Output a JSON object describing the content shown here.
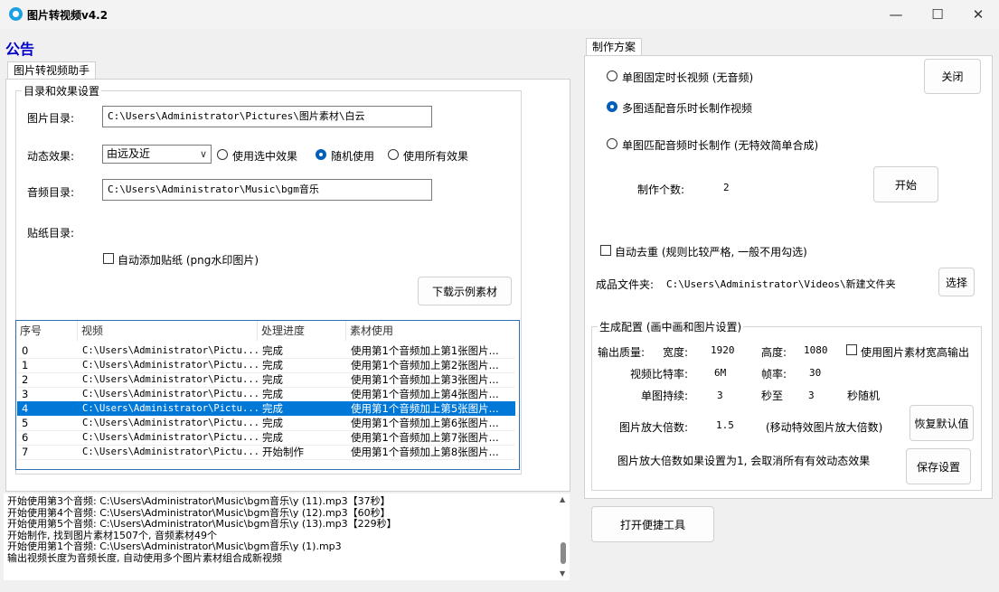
{
  "window": {
    "title": "图片转视频v4.2"
  },
  "notice_label": "公告",
  "left_tab": "图片转视频助手",
  "dir_group": {
    "title": "目录和效果设置",
    "image_dir_label": "图片目录:",
    "image_dir_value": "C:\\Users\\Administrator\\Pictures\\图片素材\\白云",
    "effect_label": "动态效果:",
    "effect_selected": "由远及近",
    "radio_selected_effect": "使用选中效果",
    "radio_random": "随机使用",
    "radio_all": "使用所有效果",
    "audio_dir_label": "音频目录:",
    "audio_dir_value": "C:\\Users\\Administrator\\Music\\bgm音乐",
    "sticker_dir_label": "贴纸目录:",
    "auto_sticker_label": "自动添加贴纸 (png水印图片)",
    "download_button": "下载示例素材"
  },
  "table": {
    "headers": [
      "序号",
      "视频",
      "处理进度",
      "素材使用"
    ],
    "rows": [
      {
        "no": "0",
        "video": "C:\\Users\\Administrator\\Pictu...",
        "progress": "完成",
        "usage": "使用第1个音频加上第1张图片..."
      },
      {
        "no": "1",
        "video": "C:\\Users\\Administrator\\Pictu...",
        "progress": "完成",
        "usage": "使用第1个音频加上第2张图片..."
      },
      {
        "no": "2",
        "video": "C:\\Users\\Administrator\\Pictu...",
        "progress": "完成",
        "usage": "使用第1个音频加上第3张图片..."
      },
      {
        "no": "3",
        "video": "C:\\Users\\Administrator\\Pictu...",
        "progress": "完成",
        "usage": "使用第1个音频加上第4张图片..."
      },
      {
        "no": "4",
        "video": "C:\\Users\\Administrator\\Pictu...",
        "progress": "完成",
        "usage": "使用第1个音频加上第5张图片..."
      },
      {
        "no": "5",
        "video": "C:\\Users\\Administrator\\Pictu...",
        "progress": "完成",
        "usage": "使用第1个音频加上第6张图片..."
      },
      {
        "no": "6",
        "video": "C:\\Users\\Administrator\\Pictu...",
        "progress": "完成",
        "usage": "使用第1个音频加上第7张图片..."
      },
      {
        "no": "7",
        "video": "C:\\Users\\Administrator\\Pictu...",
        "progress": "开始制作",
        "usage": "使用第1个音频加上第8张图片..."
      }
    ],
    "selected_row": "4"
  },
  "log_lines": [
    "开始使用第3个音频: C:\\Users\\Administrator\\Music\\bgm音乐\\y (11).mp3【37秒】",
    "开始使用第4个音频: C:\\Users\\Administrator\\Music\\bgm音乐\\y (12).mp3【60秒】",
    "开始使用第5个音频: C:\\Users\\Administrator\\Music\\bgm音乐\\y (13).mp3【229秒】",
    "开始制作, 找到图片素材1507个, 音频素材49个",
    "开始使用第1个音频: C:\\Users\\Administrator\\Music\\bgm音乐\\y (1).mp3",
    "输出视频长度为音频长度, 自动使用多个图片素材组合成新视频"
  ],
  "right_tab": "制作方案",
  "plan": {
    "option_single_fixed": "单图固定时长视频 (无音频)",
    "option_multi_music": "多图适配音乐时长制作视频",
    "option_single_audio": "单图匹配音频时长制作 (无特效简单合成)",
    "close_button": "关闭",
    "count_label": "制作个数:",
    "count_value": "2",
    "start_button": "开始",
    "dedupe_label": "自动去重 (规则比较严格, 一般不用勾选)",
    "output_dir_label": "成品文件夹:",
    "output_dir_value": "C:\\Users\\Administrator\\Videos\\新建文件夹",
    "choose_button": "选择"
  },
  "gen": {
    "title": "生成配置 (画中画和图片设置)",
    "quality_label": "输出质量:",
    "width_label": "宽度:",
    "width_value": "1920",
    "height_label": "高度:",
    "height_value": "1080",
    "use_image_size_label": "使用图片素材宽高输出",
    "bitrate_label": "视频比特率:",
    "bitrate_value": "6M",
    "fps_label": "帧率:",
    "fps_value": "30",
    "duration_label": "单图持续:",
    "duration_min": "3",
    "sec_to": "秒至",
    "duration_max": "3",
    "sec_random": "秒随机",
    "zoom_label": "图片放大倍数:",
    "zoom_value": "1.5",
    "zoom_note": "(移动特效图片放大倍数)",
    "restore_button": "恢复默认值",
    "note": "图片放大倍数如果设置为1, 会取消所有有效动态效果",
    "save_button": "保存设置"
  },
  "quick_tools_button": "打开便捷工具"
}
